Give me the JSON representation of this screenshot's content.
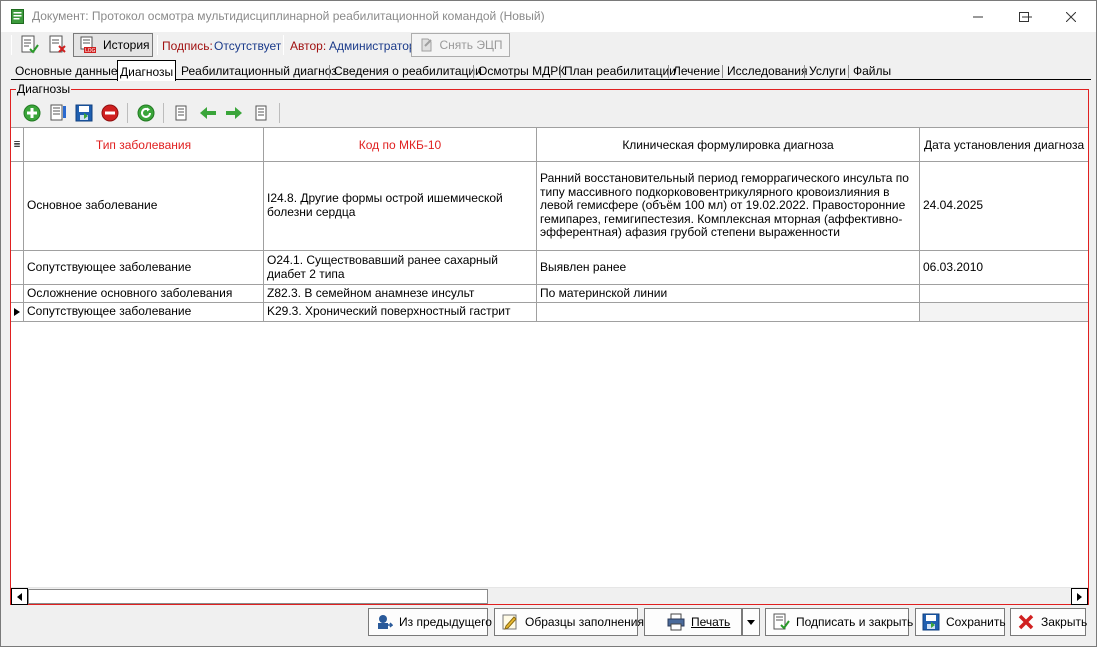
{
  "window": {
    "title": "Документ: Протокол осмотра мультидисциплинарной реабилитационной командой (Новый)"
  },
  "toolbar": {
    "history_label": "История",
    "signature_label": "Подпись:",
    "signature_value": "Отсутствует",
    "author_label": "Автор:",
    "author_value": "Администратор",
    "remove_signature_label": "Снять ЭЦП"
  },
  "tabs": [
    {
      "label": "Основные данные"
    },
    {
      "label": "Диагнозы"
    },
    {
      "label": "Реабилитационный диагноз"
    },
    {
      "label": "Сведения о реабилитации"
    },
    {
      "label": "Осмотры МДРК"
    },
    {
      "label": "План реабилитации"
    },
    {
      "label": "Лечение"
    },
    {
      "label": "Исследования"
    },
    {
      "label": "Услуги"
    },
    {
      "label": "Файлы"
    }
  ],
  "diagnoses": {
    "group_title": "Диагнозы",
    "columns": [
      "Тип заболевания",
      "Код по МКБ-10",
      "Клиническая формулировка диагноза",
      "Дата установления диагноза"
    ],
    "rows": [
      {
        "type": "Основное заболевание",
        "code": "I24.8. Другие формы острой ишемической болезни сердца",
        "formulation": "Ранний восстановительный период геморрагического инсульта по типу массивного подкоркововентрикулярного кровоизлияния в левой гемисфере (объём 100 мл) от 19.02.2022. Правосторонние гемипарез, гемигипестезия. Комплексная мторная (аффективно-эфферентная) афазия грубой степени выраженности",
        "date": "24.04.2025"
      },
      {
        "type": "Сопутствующее заболевание",
        "code": "O24.1. Существовавший ранее сахарный диабет 2 типа",
        "formulation": "Выявлен ранее",
        "date": "06.03.2010"
      },
      {
        "type": "Осложнение основного заболевания",
        "code": "Z82.3. В семейном анамнезе инсульт",
        "formulation": "По материнской линии",
        "date": ""
      },
      {
        "type": "Сопутствующее заболевание",
        "code": "K29.3. Хронический поверхностный гастрит",
        "formulation": "",
        "date": ""
      }
    ]
  },
  "footer": {
    "from_previous": "Из предыдущего",
    "templates": "Образцы заполнения",
    "print": "Печать",
    "sign_and_close": "Подписать и закрыть",
    "save": "Сохранить",
    "close": "Закрыть"
  },
  "colors": {
    "accent_red": "#e02020",
    "signature_blue": "#1a3a8a",
    "icon_green": "#3aa53a"
  }
}
